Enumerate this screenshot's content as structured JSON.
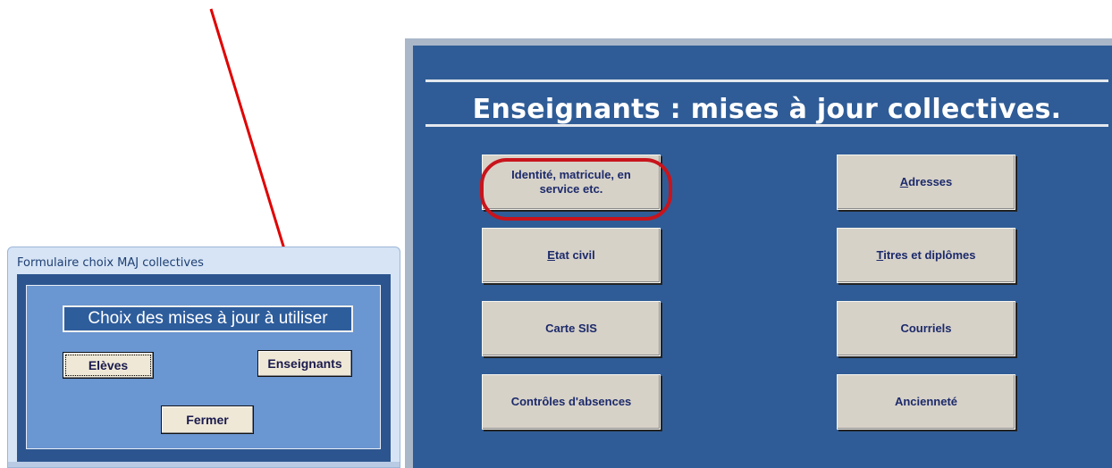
{
  "dialog": {
    "title": "Formulaire choix MAJ collectives",
    "header": "Choix des mises à jour à utiliser",
    "buttons": {
      "eleves": "Elèves",
      "enseignants": "Enseignants",
      "fermer": "Fermer"
    }
  },
  "panel": {
    "title": "Enseignants : mises à jour collectives.",
    "buttons": {
      "identite_line1": "Identité, matricule, en",
      "identite_line2": "service etc.",
      "adresses_first": "A",
      "adresses_rest": "dresses",
      "etat_first": "E",
      "etat_rest": "tat civil",
      "titres_first": "T",
      "titres_rest": "itres et diplômes",
      "carte": "Carte SIS",
      "courriels": "Courriels",
      "controles": "Contrôles d'absences",
      "anciennete": "Ancienneté"
    }
  },
  "annotations": {
    "arrow_color": "#e00000",
    "ring_color": "#c8141c"
  }
}
